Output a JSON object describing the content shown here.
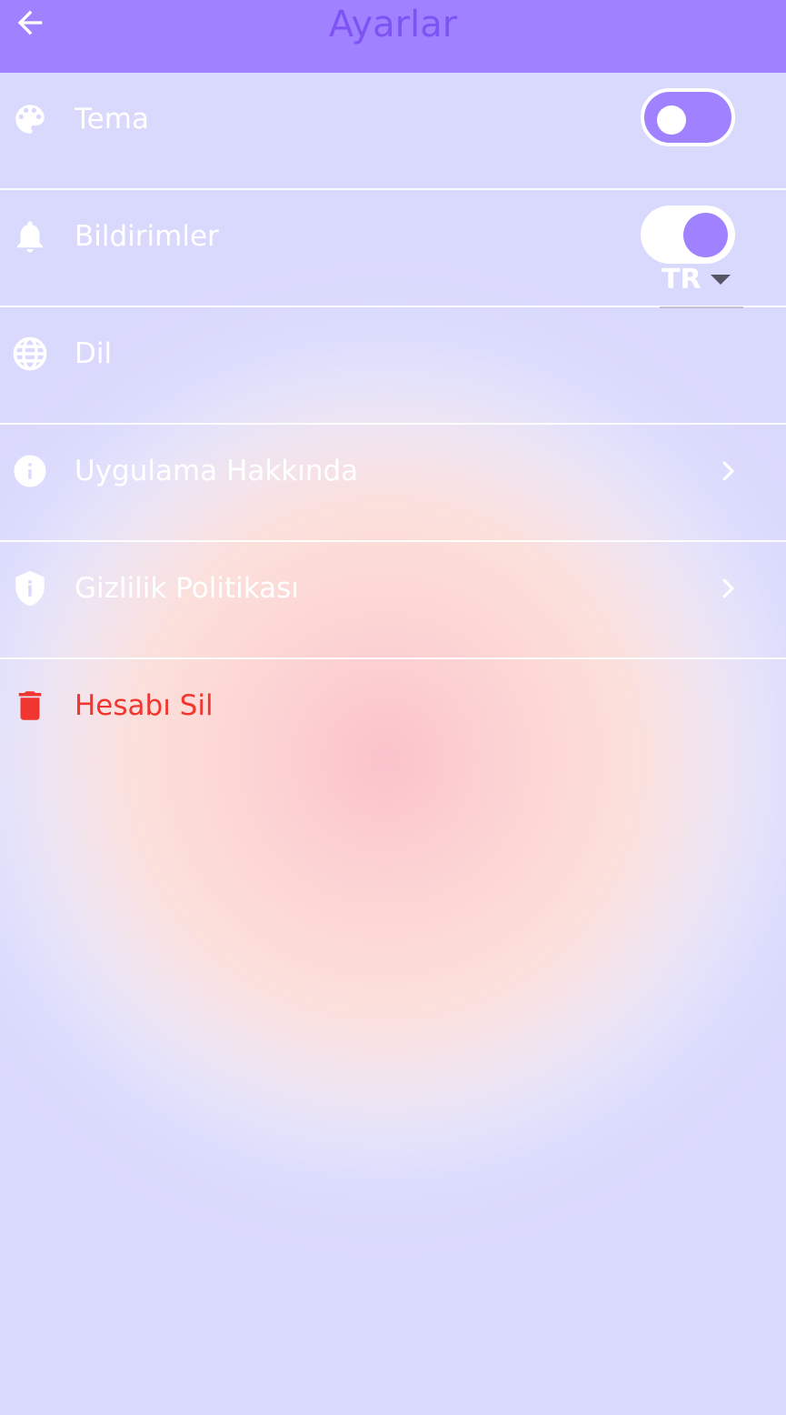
{
  "app_bar": {
    "title": "Ayarlar",
    "back_icon": "arrow-back-icon"
  },
  "settings": {
    "theme": {
      "label": "Tema",
      "icon": "palette-icon",
      "toggle": "off"
    },
    "notifications": {
      "label": "Bildirimler",
      "icon": "bell-icon",
      "toggle": "on"
    },
    "language": {
      "label": "Dil",
      "icon": "globe-icon",
      "selected": "TR"
    },
    "about": {
      "label": "Uygulama Hakkında",
      "icon": "info-icon"
    },
    "privacy": {
      "label": "Gizlilik Politikası",
      "icon": "shield-icon"
    },
    "delete_account": {
      "label": "Hesabı Sil",
      "icon": "trash-icon"
    }
  },
  "colors": {
    "accent": "#a081ff",
    "title": "#7e53f4",
    "danger": "#f0362e",
    "background": "#d9d8fd"
  }
}
